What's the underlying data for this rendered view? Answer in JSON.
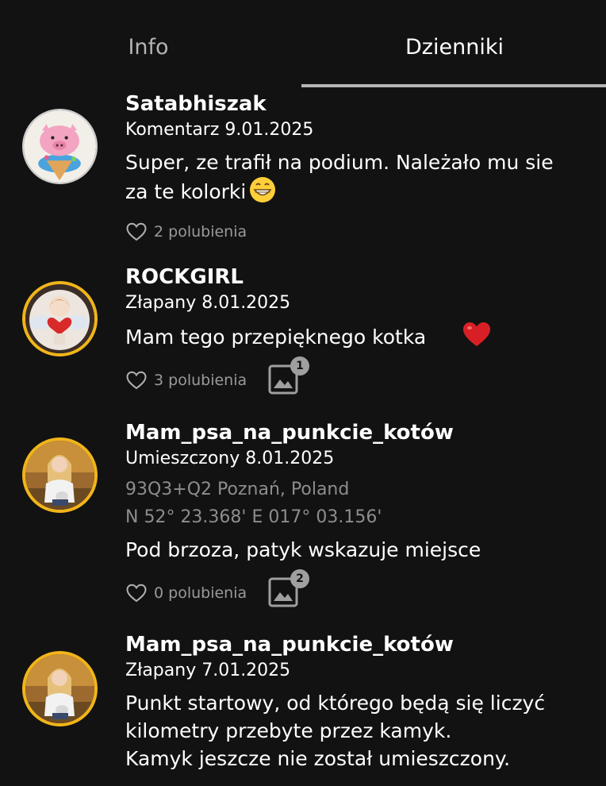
{
  "tabs": {
    "info": "Info",
    "logs": "Dzienniki"
  },
  "entries": [
    {
      "username": "Satabhiszak",
      "meta": "Komentarz 9.01.2025",
      "text_lines": [
        "Super, ze trafił na podium. Należało mu sie",
        "za te kolorki"
      ],
      "emoji": "grinning-face-icon",
      "likes": "2 polubienia"
    },
    {
      "username": "ROCKGIRL",
      "meta": "Złapany 8.01.2025",
      "text_lines": [
        "Mam tego przepięknego kotka"
      ],
      "emoji": "red-heart-icon",
      "likes": "3 polubienia",
      "photo_count": "1"
    },
    {
      "username": "Mam_psa_na_punkcie_kotów",
      "meta": "Umieszczony 8.01.2025",
      "location_lines": [
        "93Q3+Q2 Poznań, Poland",
        "N 52° 23.368' E 017° 03.156'"
      ],
      "text_lines": [
        "Pod brzoza, patyk wskazuje miejsce"
      ],
      "likes": "0 polubienia",
      "photo_count": "2"
    },
    {
      "username": "Mam_psa_na_punkcie_kotów",
      "meta": "Złapany 7.01.2025",
      "text_lines": [
        "Punkt startowy, od którego będą się liczyć",
        "kilometry przebyte przez kamyk.",
        "Kamyk jeszcze nie został umieszczony."
      ]
    }
  ],
  "colors": {
    "background": "#121212",
    "avatar_ring": "#f1b51a",
    "muted_text": "#9a9a9a",
    "tab_underline": "#b5b5b5",
    "emoji_heart": "#d91f26"
  }
}
